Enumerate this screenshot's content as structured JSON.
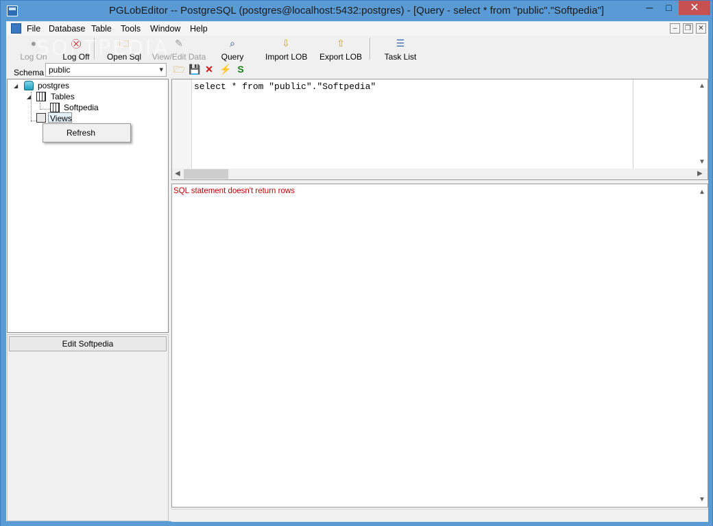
{
  "window": {
    "title": "PGLobEditor -- PostgreSQL (postgres@localhost:5432:postgres) - [Query - select * from \"public\".\"Softpedia\"]",
    "minimize_glyph": "─",
    "maximize_glyph": "□",
    "close_glyph": "✕"
  },
  "menu": {
    "items": [
      "File",
      "Database",
      "Table",
      "Tools",
      "Window",
      "Help"
    ],
    "mdi_minimize": "–",
    "mdi_restore": "❐",
    "mdi_close": "✕"
  },
  "watermark": "SOFTPEDIA",
  "toolbar": {
    "buttons": [
      {
        "label": "Log On",
        "icon": "user-icon",
        "glyph": "●",
        "enabled": false
      },
      {
        "label": "Log Off",
        "icon": "logoff-icon",
        "glyph": "⛒",
        "enabled": true
      },
      {
        "label": "Open Sql",
        "icon": "folder-icon",
        "glyph": "🗀",
        "enabled": true
      },
      {
        "label": "View/Edit Data",
        "icon": "edit-data-icon",
        "glyph": "✎",
        "enabled": false
      },
      {
        "label": "Query",
        "icon": "query-icon",
        "glyph": "⌕",
        "enabled": true
      },
      {
        "label": "Import LOB",
        "icon": "import-lob-icon",
        "glyph": "⇩",
        "enabled": true
      },
      {
        "label": "Export LOB",
        "icon": "export-lob-icon",
        "glyph": "⇧",
        "enabled": true
      },
      {
        "label": "Task List",
        "icon": "task-list-icon",
        "glyph": "☰",
        "enabled": true
      }
    ]
  },
  "schema": {
    "label": "Schema",
    "selected": "public",
    "arrow": "▾"
  },
  "tree": {
    "expander": "◢",
    "root": "postgres",
    "tables_label": "Tables",
    "table_item": "Softpedia",
    "views_label": "Views"
  },
  "context_menu": {
    "refresh": "Refresh"
  },
  "edit_button": {
    "label": "Edit Softpedia"
  },
  "sql_toolbar": {
    "open": "🗁",
    "save": "💾",
    "clear": "✕",
    "execute": "⚡",
    "refresh": "S"
  },
  "editor": {
    "code": "select * from \"public\".\"Softpedia\"",
    "arrows": {
      "up": "▲",
      "down": "▼",
      "left": "◀",
      "right": "▶"
    }
  },
  "results": {
    "message": "SQL statement doesn't return rows"
  },
  "colors": {
    "title_bar": "#5b9bd5",
    "error_text": "#cc0000",
    "close_button": "#c75050"
  }
}
